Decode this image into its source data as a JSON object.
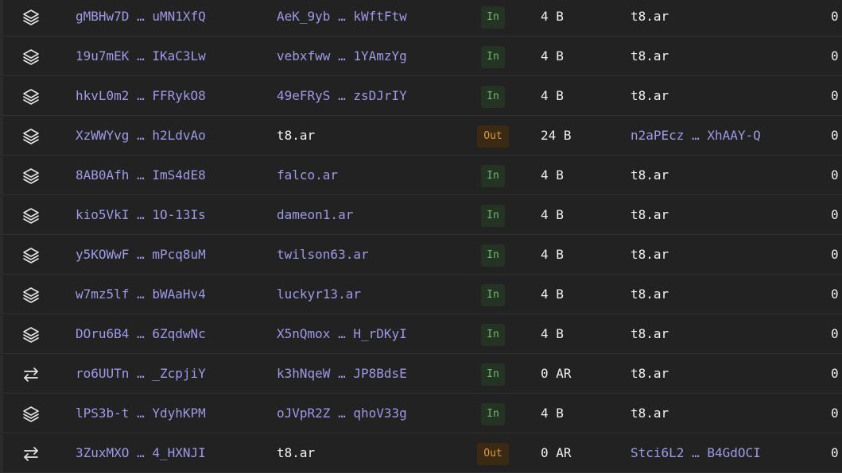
{
  "rows": [
    {
      "icon": "layers-icon",
      "id": "gMBHw7D … uMN1XfQ",
      "from": "AeK_9yb … kWftFtw",
      "from_link": true,
      "dir": "In",
      "size": "4 B",
      "to": "t8.ar",
      "to_link": false,
      "last": "0"
    },
    {
      "icon": "layers-icon",
      "id": "19u7mEK … IKaC3Lw",
      "from": "vebxfww … 1YAmzYg",
      "from_link": true,
      "dir": "In",
      "size": "4 B",
      "to": "t8.ar",
      "to_link": false,
      "last": "0"
    },
    {
      "icon": "layers-icon",
      "id": "hkvL0m2 … FFRykO8",
      "from": "49eFRyS … zsDJrIY",
      "from_link": true,
      "dir": "In",
      "size": "4 B",
      "to": "t8.ar",
      "to_link": false,
      "last": "0"
    },
    {
      "icon": "layers-icon",
      "id": "XzWWYvg … h2LdvAo",
      "from": "t8.ar",
      "from_link": false,
      "dir": "Out",
      "size": "24 B",
      "to": "n2aPEcz … XhAAY-Q",
      "to_link": true,
      "last": "0"
    },
    {
      "icon": "layers-icon",
      "id": "8AB0Afh … ImS4dE8",
      "from": "falco.ar",
      "from_link": true,
      "dir": "In",
      "size": "4 B",
      "to": "t8.ar",
      "to_link": false,
      "last": "0"
    },
    {
      "icon": "layers-icon",
      "id": "kio5VkI … 1O-13Is",
      "from": "dameon1.ar",
      "from_link": true,
      "dir": "In",
      "size": "4 B",
      "to": "t8.ar",
      "to_link": false,
      "last": "0"
    },
    {
      "icon": "layers-icon",
      "id": "y5KOWwF … mPcq8uM",
      "from": "twilson63.ar",
      "from_link": true,
      "dir": "In",
      "size": "4 B",
      "to": "t8.ar",
      "to_link": false,
      "last": "0"
    },
    {
      "icon": "layers-icon",
      "id": "w7mz5lf … bWAaHv4",
      "from": "luckyr13.ar",
      "from_link": true,
      "dir": "In",
      "size": "4 B",
      "to": "t8.ar",
      "to_link": false,
      "last": "0"
    },
    {
      "icon": "layers-icon",
      "id": "DOru6B4 … 6ZqdwNc",
      "from": "X5nQmox … H_rDKyI",
      "from_link": true,
      "dir": "In",
      "size": "4 B",
      "to": "t8.ar",
      "to_link": false,
      "last": "0"
    },
    {
      "icon": "transfer-icon",
      "id": "ro6UUTn … _ZcpjiY",
      "from": "k3hNqeW … JP8BdsE",
      "from_link": true,
      "dir": "In",
      "size": "0 AR",
      "to": "t8.ar",
      "to_link": false,
      "last": "0"
    },
    {
      "icon": "layers-icon",
      "id": "lPS3b-t … YdyhKPM",
      "from": "oJVpR2Z … qhoV33g",
      "from_link": true,
      "dir": "In",
      "size": "4 B",
      "to": "t8.ar",
      "to_link": false,
      "last": "0"
    },
    {
      "icon": "transfer-icon",
      "id": "3ZuxMXO … 4_HXNJI",
      "from": "t8.ar",
      "from_link": false,
      "dir": "Out",
      "size": "0 AR",
      "to": "Stci6L2 … B4GdOCI",
      "to_link": true,
      "last": "0"
    }
  ],
  "colors": {
    "background": "#222222",
    "link": "#9d99e6",
    "in_badge_text": "#6db86d",
    "in_badge_bg": "#243324",
    "out_badge_text": "#d99a3c",
    "out_badge_bg": "#3a2a14"
  }
}
